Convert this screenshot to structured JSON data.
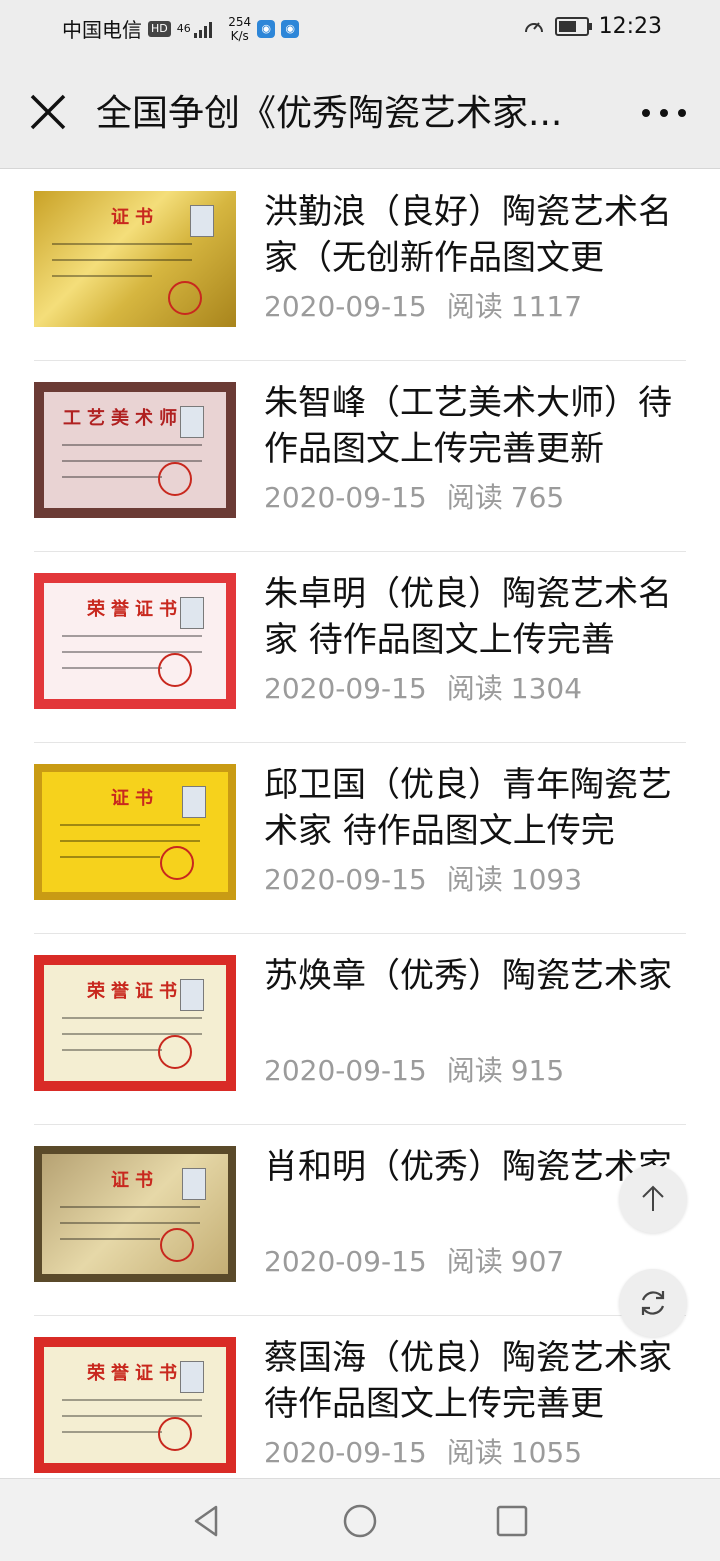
{
  "status_bar": {
    "carrier": "中国电信",
    "hd_badge": "HD",
    "signal": "46",
    "net_speed_value": "254",
    "net_speed_unit": "K/s",
    "time": "12:23",
    "battery_level": 0.8
  },
  "header": {
    "title": "全国争创《优秀陶瓷艺术家..."
  },
  "articles": [
    {
      "title": "洪勤浪（良好）陶瓷艺术名家（无创新作品图文更",
      "date": "2020-09-15",
      "reads_label": "阅读",
      "reads": "1117",
      "cert_text": "证书",
      "cert_style": "gold"
    },
    {
      "title": "朱智峰（工艺美术大师）待作品图文上传完善更新",
      "date": "2020-09-15",
      "reads_label": "阅读",
      "reads": "765",
      "cert_text": "工艺美术师证",
      "cert_style": "pink-cert"
    },
    {
      "title": "朱卓明（优良）陶瓷艺术名家 待作品图文上传完善",
      "date": "2020-09-15",
      "reads_label": "阅读",
      "reads": "1304",
      "cert_text": "荣誉证书",
      "cert_style": "red-frame"
    },
    {
      "title": "邱卫国（优良）青年陶瓷艺术家 待作品图文上传完",
      "date": "2020-09-15",
      "reads_label": "阅读",
      "reads": "1093",
      "cert_text": "证书",
      "cert_style": "gold-yellow"
    },
    {
      "title": "苏焕章（优秀）陶瓷艺术家",
      "date": "2020-09-15",
      "reads_label": "阅读",
      "reads": "915",
      "cert_text": "荣誉证书",
      "cert_style": "red-frame2"
    },
    {
      "title": "肖和明（优秀）陶瓷艺术家",
      "date": "2020-09-15",
      "reads_label": "阅读",
      "reads": "907",
      "cert_text": "证书",
      "cert_style": "dark-gold"
    },
    {
      "title": "蔡国海（优良）陶瓷艺术家 待作品图文上传完善更",
      "date": "2020-09-15",
      "reads_label": "阅读",
      "reads": "1055",
      "cert_text": "荣誉证书",
      "cert_style": "red-frame2"
    }
  ],
  "icons": {
    "close": "close-icon",
    "more": "more-icon",
    "scroll_top": "arrow-up-icon",
    "refresh": "refresh-icon",
    "nav_back": "triangle-back-icon",
    "nav_home": "circle-home-icon",
    "nav_recents": "square-recents-icon"
  },
  "colors": {
    "header_bg": "#ededed",
    "meta_text": "#9b9b9b",
    "cert_red": "#c8281e"
  }
}
